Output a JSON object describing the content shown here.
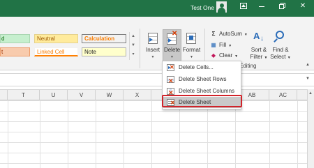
{
  "window": {
    "user_name": "Test One",
    "close_glyph": "✕"
  },
  "cell_styles": {
    "good_partial": "d",
    "neutral": "Neutral",
    "calculation": "Calculation",
    "output_partial": "t",
    "linked_cell": "Linked Cell",
    "note": "Note"
  },
  "ribbon": {
    "insert": "Insert",
    "delete": "Delete",
    "format": "Format",
    "autosum": "AutoSum",
    "fill": "Fill",
    "clear": "Clear",
    "sort_filter": [
      "Sort &",
      "Filter"
    ],
    "find_select": [
      "Find &",
      "Select"
    ],
    "group_label": "Editing"
  },
  "delete_menu": [
    {
      "label": "Delete Cells...",
      "icon": "delete-cells-icon"
    },
    {
      "label": "Delete Sheet Rows",
      "icon": "delete-rows-icon"
    },
    {
      "label": "Delete Sheet Columns",
      "icon": "delete-columns-icon"
    },
    {
      "label": "Delete Sheet",
      "icon": "delete-sheet-icon",
      "selected": true
    }
  ],
  "columns": [
    "T",
    "U",
    "V",
    "W",
    "X",
    "Y",
    "Z",
    "AA",
    "AB",
    "AC"
  ],
  "colors": {
    "title_bar": "#217346",
    "highlight": "#d1232a"
  }
}
